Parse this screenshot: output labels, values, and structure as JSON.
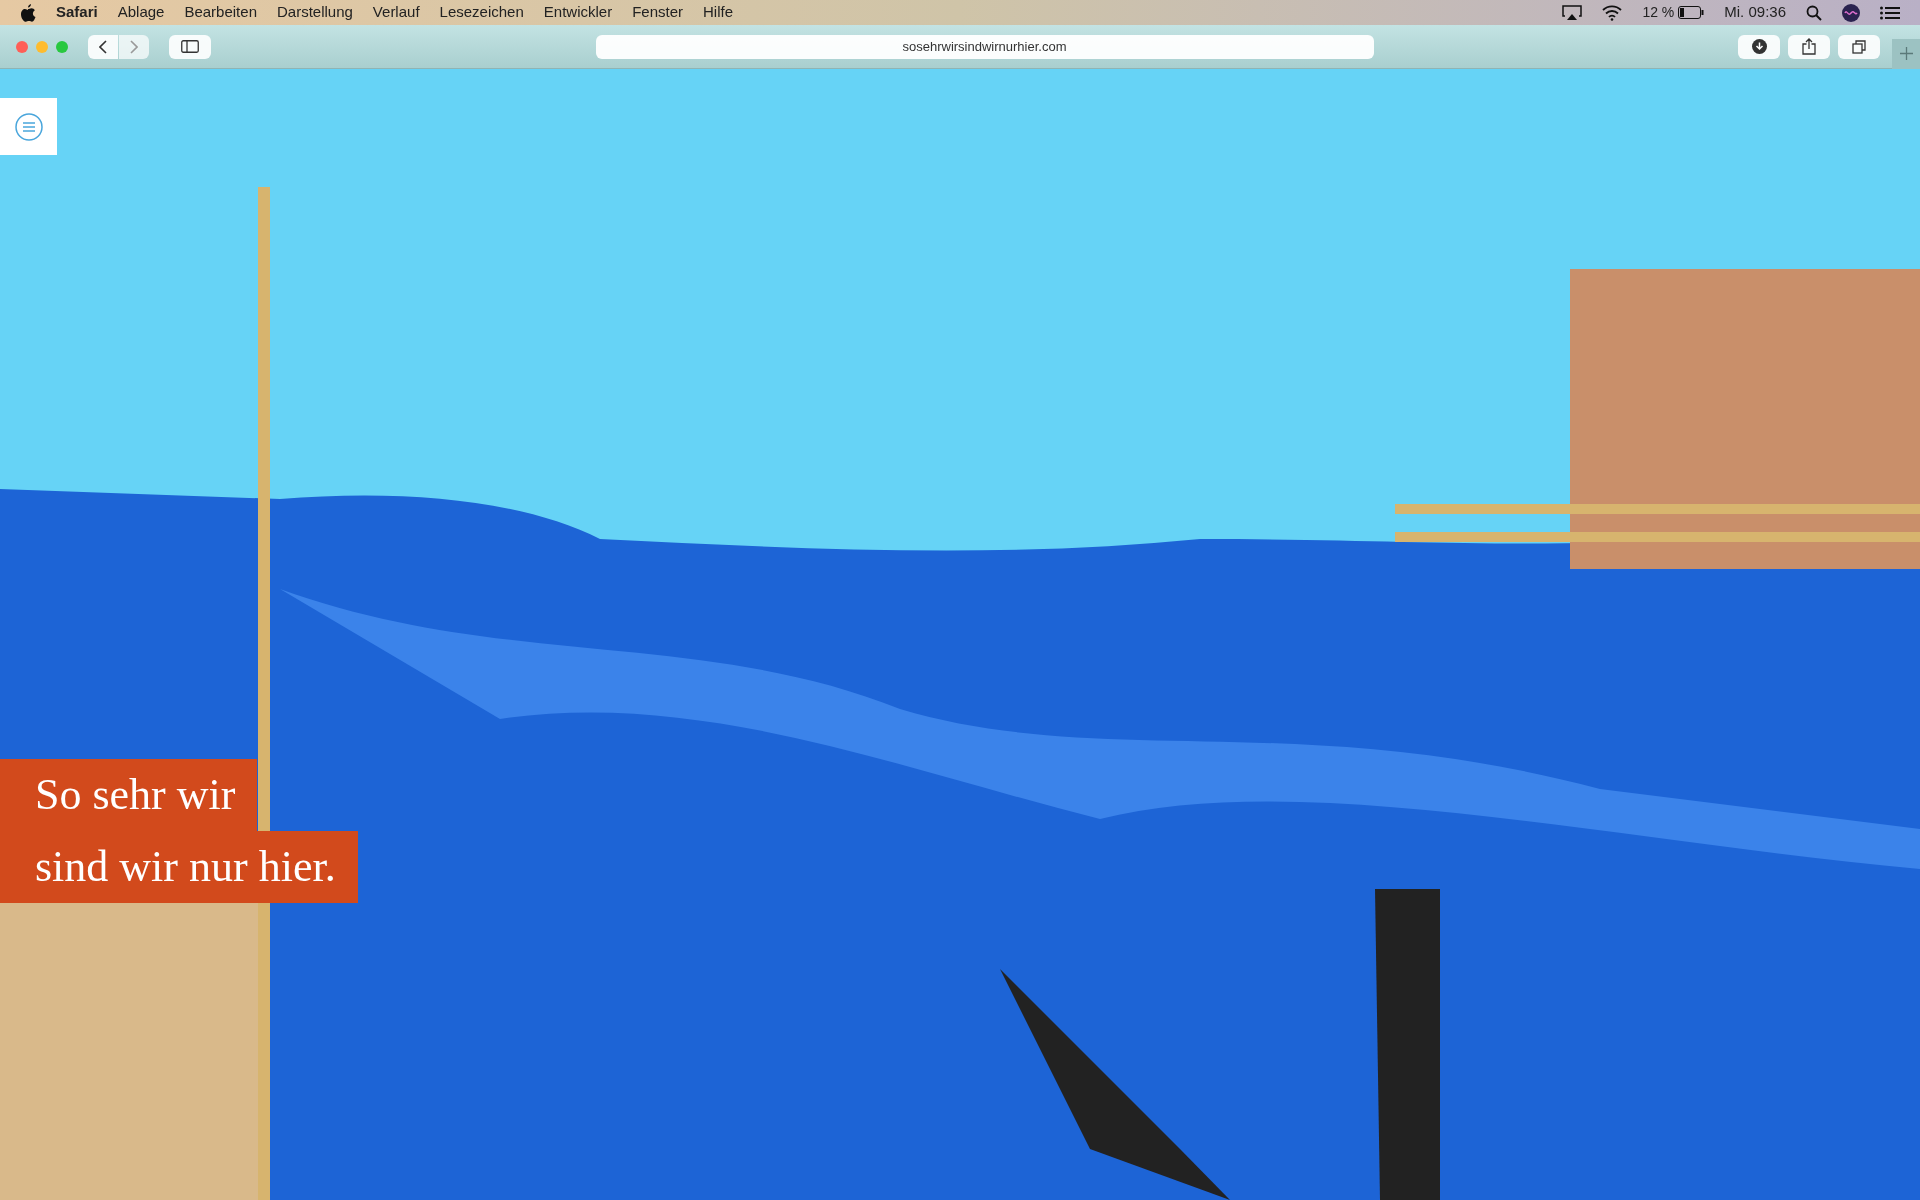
{
  "menu_bar": {
    "app": "Safari",
    "items": [
      "Ablage",
      "Bearbeiten",
      "Darstellung",
      "Verlauf",
      "Lesezeichen",
      "Entwickler",
      "Fenster",
      "Hilfe"
    ],
    "battery": "12 %",
    "clock": "Mi. 09:36"
  },
  "toolbar": {
    "url": "sosehrwirsindwirnurhier.com"
  },
  "page": {
    "headline": [
      "So sehr wir",
      "sind wir nur hier."
    ]
  }
}
